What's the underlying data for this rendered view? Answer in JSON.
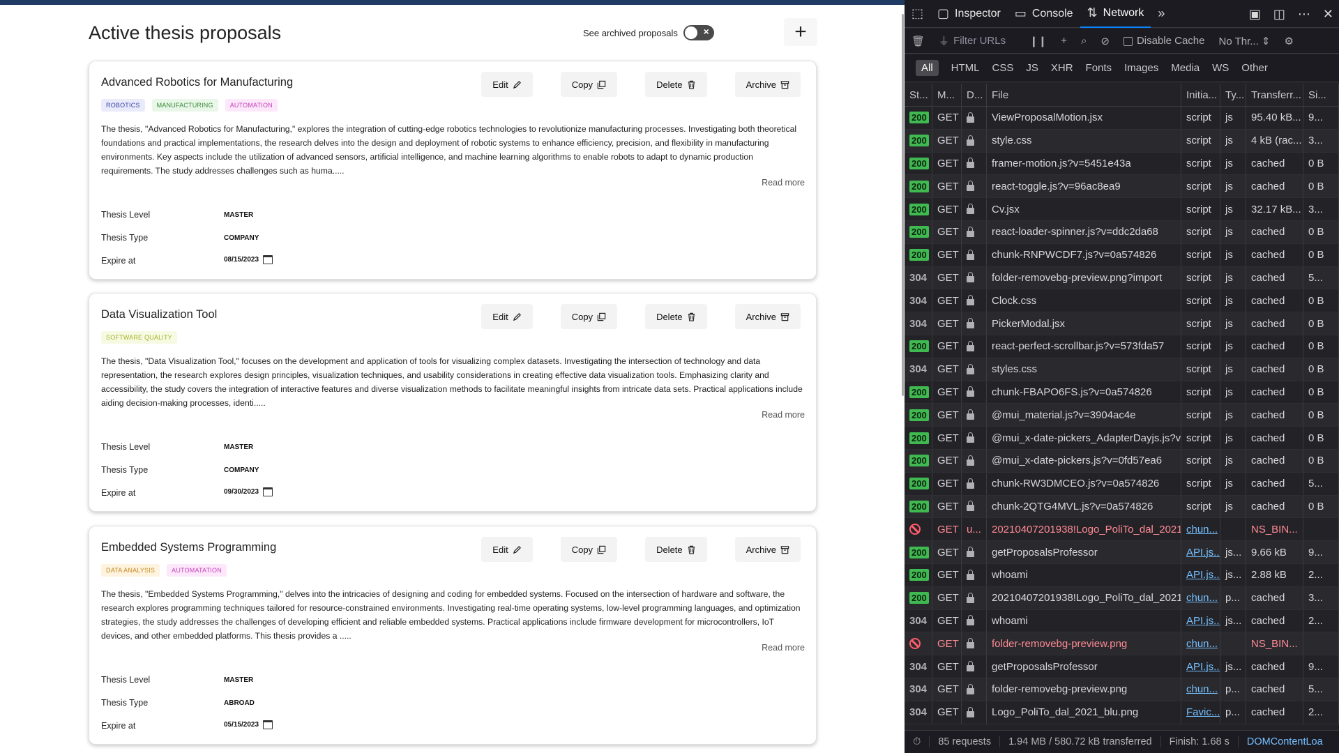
{
  "page": {
    "title": "Active thesis proposals",
    "archived_toggle_label": "See archived proposals",
    "add_label": "+",
    "read_more_label": "Read more",
    "meta_labels": {
      "level": "Thesis Level",
      "type": "Thesis Type",
      "expire": "Expire at"
    },
    "action_labels": {
      "edit": "Edit",
      "copy": "Copy",
      "delete": "Delete",
      "archive": "Archive"
    }
  },
  "proposals": [
    {
      "title": "Advanced Robotics for Manufacturing",
      "tags": [
        "ROBOTICS",
        "MANUFACTURING",
        "AUTOMATION"
      ],
      "description": "The thesis, \"Advanced Robotics for Manufacturing,\" explores the integration of cutting-edge robotics technologies to revolutionize manufacturing processes. Investigating both theoretical foundations and practical implementations, the research delves into the design and deployment of robotic systems to enhance efficiency, precision, and flexibility in manufacturing environments. Key aspects include the utilization of advanced sensors, artificial intelligence, and machine learning algorithms to enable robots to adapt to dynamic production requirements. The study addresses challenges such as huma.....",
      "level": "MASTER",
      "type": "COMPANY",
      "expire": "08/15/2023"
    },
    {
      "title": "Data Visualization Tool",
      "tags": [
        "SOFTWARE QUALITY"
      ],
      "description": "The thesis, \"Data Visualization Tool,\" focuses on the development and application of tools for visualizing complex datasets. Investigating the intersection of technology and data representation, the research explores design principles, visualization techniques, and usability considerations in creating effective data visualization tools. Emphasizing clarity and accessibility, the study covers the integration of interactive features and diverse visualization methods to facilitate meaningful insights from intricate data sets. Practical applications include aiding decision-making processes, identi.....",
      "level": "MASTER",
      "type": "COMPANY",
      "expire": "09/30/2023"
    },
    {
      "title": "Embedded Systems Programming",
      "tags": [
        "DATA ANALYSIS",
        "AUTOMATATION"
      ],
      "description": "The thesis, \"Embedded Systems Programming,\" delves into the intricacies of designing and coding for embedded systems. Focused on the intersection of hardware and software, the research explores programming techniques tailored for resource-constrained environments. Investigating real-time operating systems, low-level programming languages, and optimization strategies, the study addresses the challenges of developing efficient and reliable embedded systems. Practical applications include firmware development for microcontrollers, IoT devices, and other embedded platforms. This thesis provides a .....",
      "level": "MASTER",
      "type": "ABROAD",
      "expire": "05/15/2023"
    }
  ],
  "devtools": {
    "tabs": [
      {
        "label": "Inspector",
        "icon": "inspector-icon"
      },
      {
        "label": "Console",
        "icon": "console-icon"
      },
      {
        "label": "Network",
        "icon": "network-icon"
      }
    ],
    "toolbar": {
      "filter_placeholder": "Filter URLs",
      "disable_cache": "Disable Cache",
      "throttle": "No Thr..."
    },
    "types": [
      "All",
      "HTML",
      "CSS",
      "JS",
      "XHR",
      "Fonts",
      "Images",
      "Media",
      "WS",
      "Other"
    ],
    "columns": [
      "St...",
      "M...",
      "D...",
      "File",
      "Initia...",
      "Ty...",
      "Transferr...",
      "Si..."
    ],
    "requests": [
      {
        "status": "200",
        "method": "GET",
        "domain": "lock",
        "file": "ViewProposalMotion.jsx",
        "initiator": "script",
        "type": "js",
        "transferred": "95.40 kB...",
        "size": "9..."
      },
      {
        "status": "200",
        "method": "GET",
        "domain": "lock",
        "file": "style.css",
        "initiator": "script",
        "type": "js",
        "transferred": "4 kB (rac...",
        "size": "3..."
      },
      {
        "status": "200",
        "method": "GET",
        "domain": "lock",
        "file": "framer-motion.js?v=5451e43a",
        "initiator": "script",
        "type": "js",
        "transferred": "cached",
        "size": "0 B"
      },
      {
        "status": "200",
        "method": "GET",
        "domain": "lock",
        "file": "react-toggle.js?v=96ac8ea9",
        "initiator": "script",
        "type": "js",
        "transferred": "cached",
        "size": "0 B"
      },
      {
        "status": "200",
        "method": "GET",
        "domain": "lock",
        "file": "Cv.jsx",
        "initiator": "script",
        "type": "js",
        "transferred": "32.17 kB...",
        "size": "3..."
      },
      {
        "status": "200",
        "method": "GET",
        "domain": "lock",
        "file": "react-loader-spinner.js?v=ddc2da68",
        "initiator": "script",
        "type": "js",
        "transferred": "cached",
        "size": "0 B"
      },
      {
        "status": "200",
        "method": "GET",
        "domain": "lock",
        "file": "chunk-RNPWCDF7.js?v=0a574826",
        "initiator": "script",
        "type": "js",
        "transferred": "cached",
        "size": "0 B"
      },
      {
        "status": "304",
        "method": "GET",
        "domain": "lock",
        "file": "folder-removebg-preview.png?import",
        "initiator": "script",
        "type": "js",
        "transferred": "cached",
        "size": "5..."
      },
      {
        "status": "304",
        "method": "GET",
        "domain": "lock",
        "file": "Clock.css",
        "initiator": "script",
        "type": "js",
        "transferred": "cached",
        "size": "0 B"
      },
      {
        "status": "304",
        "method": "GET",
        "domain": "lock",
        "file": "PickerModal.jsx",
        "initiator": "script",
        "type": "js",
        "transferred": "cached",
        "size": "0 B"
      },
      {
        "status": "200",
        "method": "GET",
        "domain": "lock",
        "file": "react-perfect-scrollbar.js?v=573fda57",
        "initiator": "script",
        "type": "js",
        "transferred": "cached",
        "size": "0 B"
      },
      {
        "status": "304",
        "method": "GET",
        "domain": "lock",
        "file": "styles.css",
        "initiator": "script",
        "type": "js",
        "transferred": "cached",
        "size": "0 B"
      },
      {
        "status": "200",
        "method": "GET",
        "domain": "lock",
        "file": "chunk-FBAPO6FS.js?v=0a574826",
        "initiator": "script",
        "type": "js",
        "transferred": "cached",
        "size": "0 B"
      },
      {
        "status": "200",
        "method": "GET",
        "domain": "lock",
        "file": "@mui_material.js?v=3904ac4e",
        "initiator": "script",
        "type": "js",
        "transferred": "cached",
        "size": "0 B"
      },
      {
        "status": "200",
        "method": "GET",
        "domain": "lock",
        "file": "@mui_x-date-pickers_AdapterDayjs.js?v=",
        "initiator": "script",
        "type": "js",
        "transferred": "cached",
        "size": "0 B"
      },
      {
        "status": "200",
        "method": "GET",
        "domain": "lock",
        "file": "@mui_x-date-pickers.js?v=0fd57ea6",
        "initiator": "script",
        "type": "js",
        "transferred": "cached",
        "size": "0 B"
      },
      {
        "status": "200",
        "method": "GET",
        "domain": "lock",
        "file": "chunk-RW3DMCEO.js?v=0a574826",
        "initiator": "script",
        "type": "js",
        "transferred": "cached",
        "size": "5..."
      },
      {
        "status": "200",
        "method": "GET",
        "domain": "lock",
        "file": "chunk-2QTG4MVL.js?v=0a574826",
        "initiator": "script",
        "type": "js",
        "transferred": "cached",
        "size": "0 B"
      },
      {
        "status": "blocked",
        "method": "GET",
        "domain": "u...",
        "file": "20210407201938!Logo_PoliTo_dal_2021_b",
        "initiator": "chun...",
        "type": "",
        "transferred": "NS_BIN...",
        "size": ""
      },
      {
        "status": "200",
        "method": "GET",
        "domain": "lock",
        "file": "getProposalsProfessor",
        "initiator": "API.js...",
        "type": "js...",
        "transferred": "9.66 kB",
        "size": "9..."
      },
      {
        "status": "200",
        "method": "GET",
        "domain": "lock",
        "file": "whoami",
        "initiator": "API.js...",
        "type": "js...",
        "transferred": "2.88 kB",
        "size": "2..."
      },
      {
        "status": "200",
        "method": "GET",
        "domain": "lock",
        "file": "20210407201938!Logo_PoliTo_dal_2021_b",
        "initiator": "chun...",
        "type": "p...",
        "transferred": "cached",
        "size": "3..."
      },
      {
        "status": "304",
        "method": "GET",
        "domain": "lock",
        "file": "whoami",
        "initiator": "API.js...",
        "type": "js...",
        "transferred": "cached",
        "size": "2..."
      },
      {
        "status": "blocked",
        "method": "GET",
        "domain": "lock",
        "file": "folder-removebg-preview.png",
        "initiator": "chun...",
        "type": "",
        "transferred": "NS_BIN...",
        "size": ""
      },
      {
        "status": "304",
        "method": "GET",
        "domain": "lock",
        "file": "getProposalsProfessor",
        "initiator": "API.js...",
        "type": "js...",
        "transferred": "cached",
        "size": "9..."
      },
      {
        "status": "304",
        "method": "GET",
        "domain": "lock",
        "file": "folder-removebg-preview.png",
        "initiator": "chun...",
        "type": "p...",
        "transferred": "cached",
        "size": "5..."
      },
      {
        "status": "304",
        "method": "GET",
        "domain": "lock",
        "file": "Logo_PoliTo_dal_2021_blu.png",
        "initiator": "Favic...",
        "type": "p...",
        "transferred": "cached",
        "size": "2..."
      }
    ],
    "status_bar": {
      "requests": "85 requests",
      "size": "1.94 MB / 580.72 kB transferred",
      "finish": "Finish: 1.68 s",
      "dom": "DOMContentLoa"
    }
  },
  "colors": {
    "top_bar": "#1f3b63",
    "status_ok": "#3fb950",
    "status_error": "#ff5a6a",
    "devtools_bg": "#232327",
    "link": "#75bfff"
  }
}
